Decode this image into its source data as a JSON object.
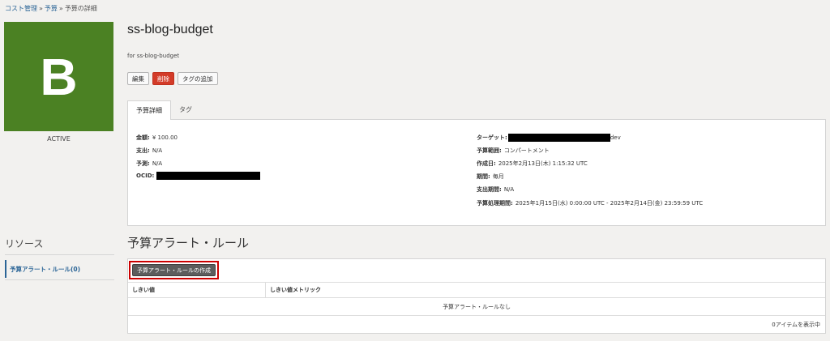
{
  "breadcrumb": {
    "items": [
      "コスト管理",
      "予算",
      "予算の詳細"
    ],
    "separator": "»"
  },
  "avatar": {
    "letter": "B",
    "color": "#4b8123"
  },
  "status": "ACTIVE",
  "budget": {
    "name": "ss-blog-budget",
    "description": "for ss-blog-budget"
  },
  "actions": {
    "edit": "編集",
    "delete": "削除",
    "add_tags": "タグの追加"
  },
  "tabs": [
    "予算詳細",
    "タグ"
  ],
  "details": {
    "amount": {
      "label": "金額:",
      "value": "¥ 100.00"
    },
    "spend": {
      "label": "支出:",
      "value": "N/A"
    },
    "forecast": {
      "label": "予測:",
      "value": "N/A"
    },
    "ocid": {
      "label": "OCID:",
      "value": ""
    },
    "target": {
      "label": "ターゲット:",
      "value": "dev"
    },
    "scope": {
      "label": "予算範囲:",
      "value": "コンパートメント"
    },
    "created": {
      "label": "作成日:",
      "value": "2025年2月13日(木) 1:15:32 UTC"
    },
    "period": {
      "label": "期間:",
      "value": "毎月"
    },
    "spend_period": {
      "label": "支出期間:",
      "value": "N/A"
    },
    "processing_period": {
      "label": "予算処理期間:",
      "value": "2025年1月15日(水) 0:00:00 UTC - 2025年2月14日(金) 23:59:59 UTC"
    }
  },
  "resources": {
    "title": "リソース",
    "items": [
      "予算アラート・ルール(0)"
    ]
  },
  "alert_rules": {
    "title": "予算アラート・ルール",
    "create_button": "予算アラート・ルールの作成",
    "columns": [
      "しきい値",
      "しきい値メトリック"
    ],
    "empty_text": "予算アラート・ルールなし",
    "count_text": "0アイテムを表示中"
  },
  "colors": {
    "accent": "#2a6496",
    "danger": "#d33b28",
    "highlight": "#cc0000"
  }
}
